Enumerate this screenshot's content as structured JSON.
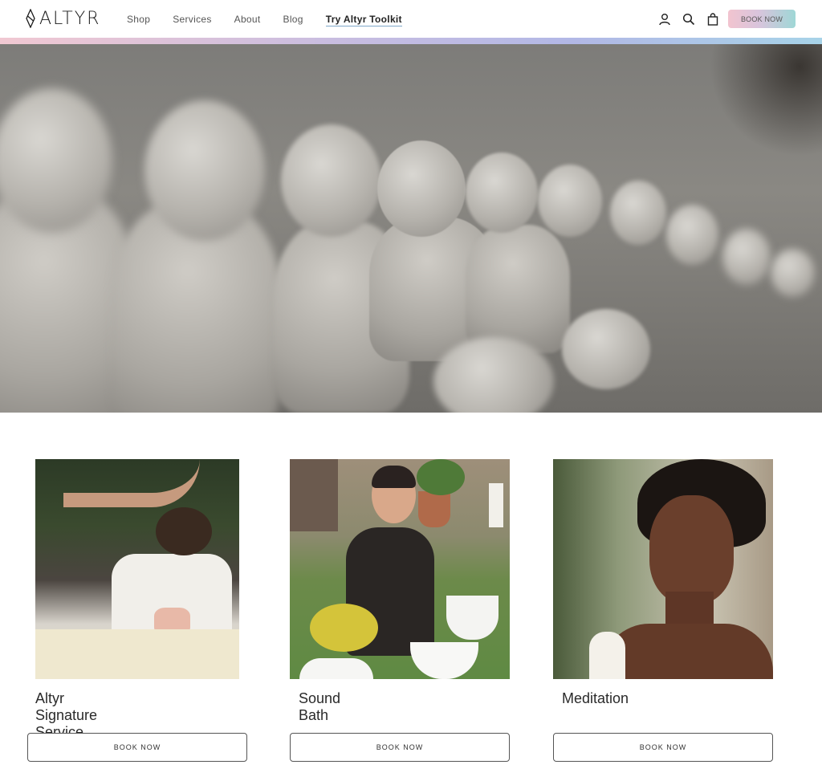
{
  "brand": {
    "name": "ALTYR"
  },
  "nav": {
    "items": [
      {
        "label": "Shop"
      },
      {
        "label": "Services"
      },
      {
        "label": "About"
      },
      {
        "label": "Blog"
      },
      {
        "label": "Try Altyr Toolkit"
      }
    ]
  },
  "header_icons": [
    "account-icon",
    "search-icon",
    "cart-icon"
  ],
  "header_cta": "BOOK NOW",
  "carousel": {
    "slide_count": 5,
    "active_index": 3
  },
  "services": [
    {
      "title": "Altyr Signature Service",
      "button": "BOOK NOW"
    },
    {
      "title": "Sound Bath",
      "button": "BOOK NOW"
    },
    {
      "title": "Meditation",
      "button": "BOOK NOW"
    }
  ],
  "colors": {
    "accent_gradient_start": "#f2c4cf",
    "accent_gradient_end": "#9fd7d6",
    "text": "#222222"
  }
}
